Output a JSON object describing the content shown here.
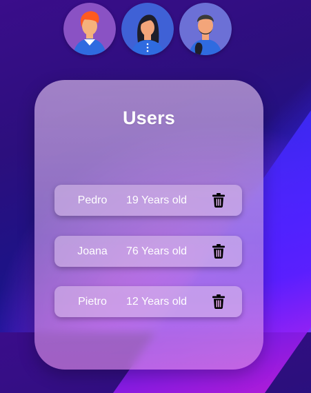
{
  "title": "Users",
  "avatars": [
    {
      "name": "red-haired-man-avatar",
      "bg": "#8a52c4",
      "hair": "#ff5a1f",
      "skin": "#f5b27c",
      "shirt": "#2f6be0"
    },
    {
      "name": "dark-haired-woman-avatar",
      "bg": "#3f61d6",
      "hair": "#1e1e2a",
      "skin": "#f3a57a",
      "shirt": "#2f6be0"
    },
    {
      "name": "bearded-man-avatar",
      "bg": "#6c70d6",
      "hair": "#3a3a3a",
      "skin": "#f3a57a",
      "shirt": "#2f6be0"
    }
  ],
  "users": [
    {
      "name": "Pedro",
      "age": "19 Years old"
    },
    {
      "name": "Joana",
      "age": "76 Years old"
    },
    {
      "name": "Pietro",
      "age": "12 Years old"
    }
  ],
  "icons": {
    "delete": "trash-icon"
  }
}
